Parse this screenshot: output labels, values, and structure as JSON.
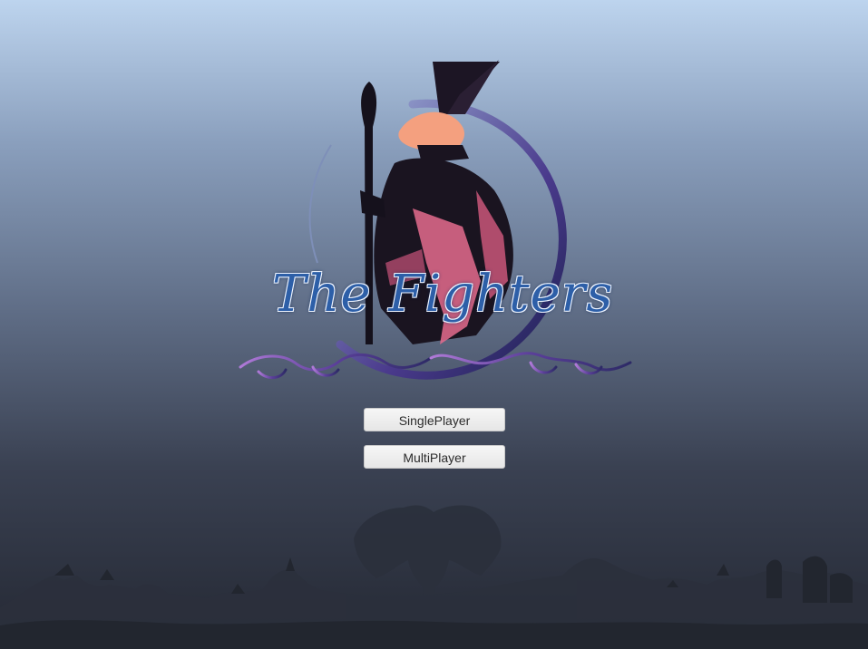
{
  "game": {
    "title": "The Fighters"
  },
  "menu": {
    "single_label": "SinglePlayer",
    "multi_label": "MultiPlayer"
  },
  "colors": {
    "title_blue": "#2d5fa8",
    "wizard_dark": "#1a1420",
    "wizard_pink": "#e56b8e",
    "hat_peach": "#f4a07f",
    "ring_purple": "#4a3a8c",
    "vine_purple": "#8e5fb8",
    "silhouette": "#272b36",
    "button_bg": "#f0f0f0"
  },
  "icons": {
    "logo": "wizard-emblem",
    "background": "monster-silhouettes"
  }
}
